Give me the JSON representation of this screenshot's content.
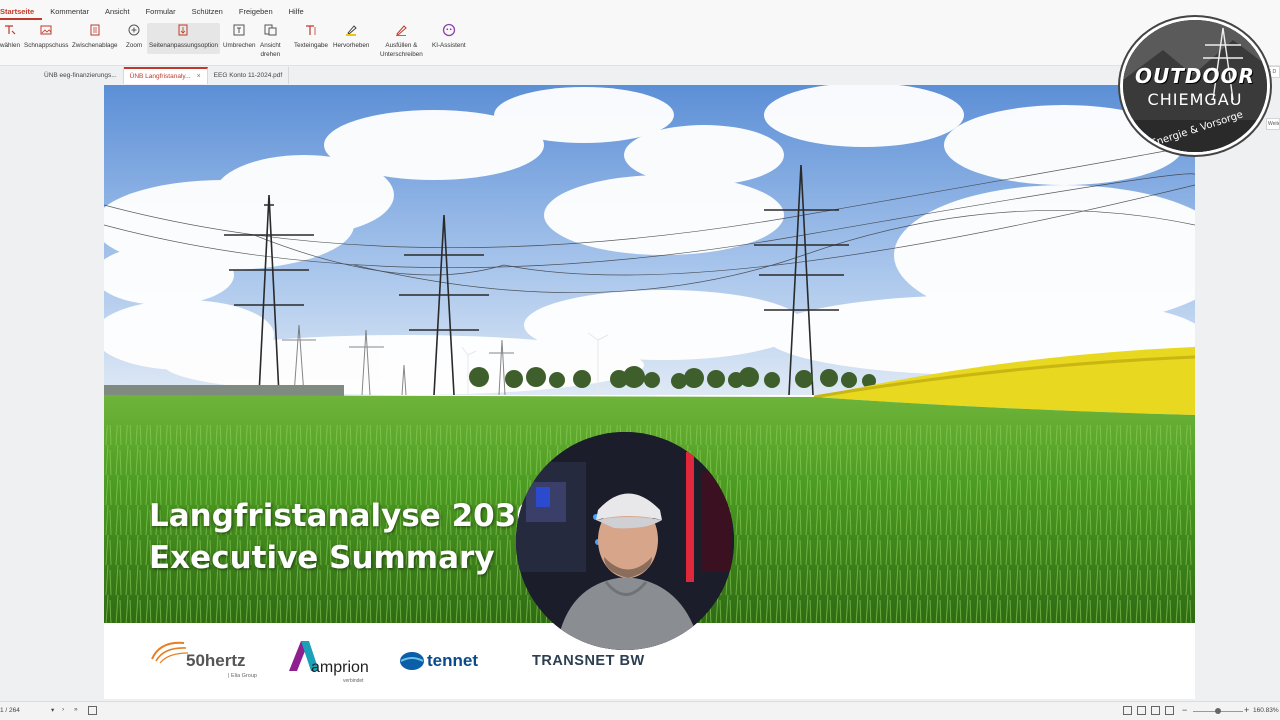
{
  "menu": [
    "Startseite",
    "Kommentar",
    "Ansicht",
    "Formular",
    "Schützen",
    "Freigeben",
    "Hilfe"
  ],
  "toolbar": {
    "waehlen": "wählen",
    "schnappschuss": "Schnappschuss",
    "zwischenablage": "Zwischenablage",
    "zoom": "Zoom",
    "seitenanpassung": "Seitenanpassungsoption",
    "umbrechen": "Umbrechen",
    "ansicht": "Ansicht",
    "drehen": "drehen",
    "texteingabe": "Texteingabe",
    "hervorheben": "Hervorheben",
    "ausfuellen": "Ausfüllen &",
    "unterschreiben": "Unterschreiben",
    "ki": "KI-Assistent"
  },
  "tabs": [
    {
      "label": "ÜNB eeg-finanzierungs..."
    },
    {
      "label": "ÜNB Langfristanaly..."
    },
    {
      "label": "EEG Konto 11-2024.pdf"
    }
  ],
  "slide": {
    "title_line1": "Langfristanalyse 2030",
    "title_line2": "Executive Summary",
    "logos": {
      "hertz": "50hertz",
      "hertz_sub": "| Elia Group",
      "amprion": "amprion",
      "amprion_sub": "verbindet",
      "tennet": "tennet",
      "transnet": "TRANSNET BW"
    }
  },
  "badge": {
    "line1": "OUTDOOR",
    "line2": "CHIEMGAU",
    "line3": "Energie & Vorsorge"
  },
  "right_panel": {
    "a": "F D",
    "b": "Weite"
  },
  "status": {
    "page": "1 / 264",
    "zoom": "160.83%"
  }
}
